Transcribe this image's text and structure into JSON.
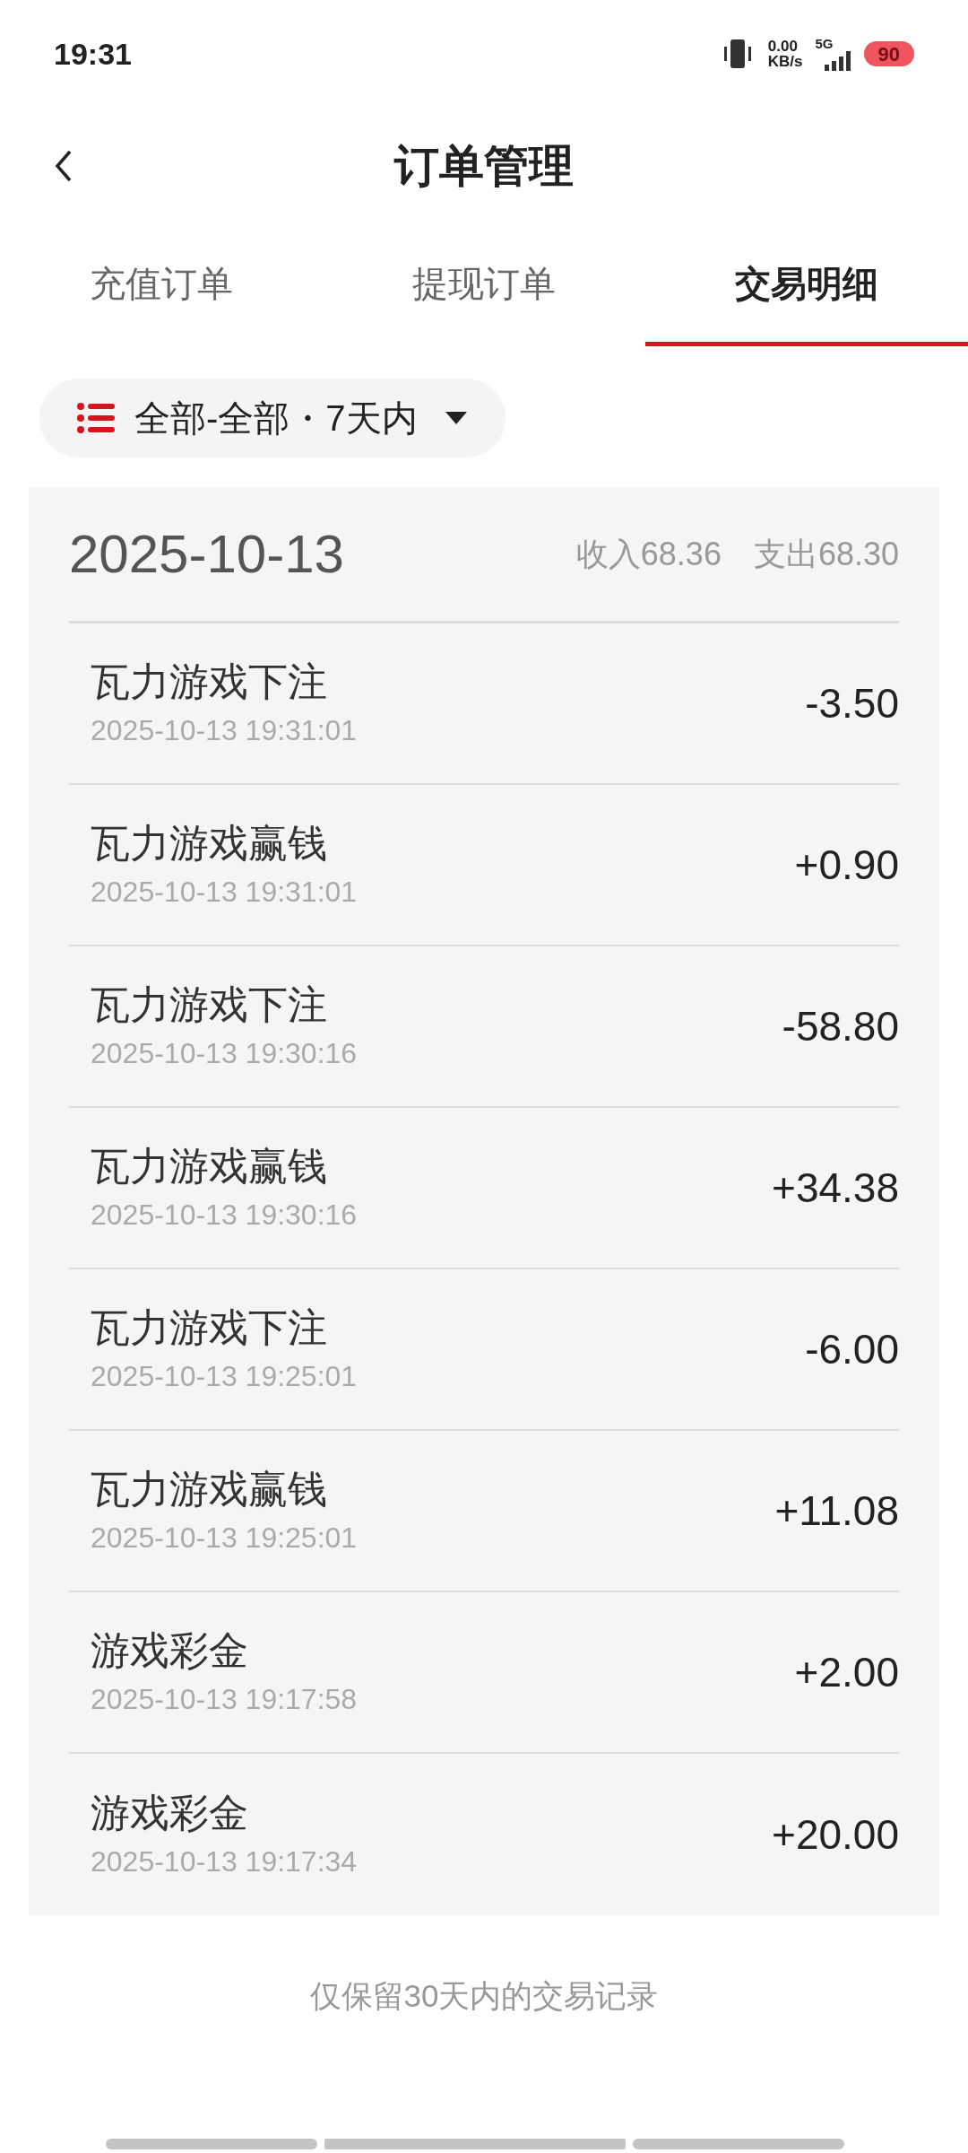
{
  "status_bar": {
    "time": "19:31",
    "speed_value": "0.00",
    "speed_unit": "KB/s",
    "network": "5G",
    "battery": "90"
  },
  "header": {
    "title": "订单管理"
  },
  "tabs": [
    {
      "label": "充值订单",
      "selected": false
    },
    {
      "label": "提现订单",
      "selected": false
    },
    {
      "label": "交易明细",
      "selected": true
    }
  ],
  "filter": {
    "label": "全部-全部・7天内"
  },
  "day": {
    "date": "2025-10-13",
    "income": "收入68.36",
    "expense": "支出68.30"
  },
  "transactions": [
    {
      "title": "瓦力游戏下注",
      "time": "2025-10-13 19:31:01",
      "amount": "-3.50"
    },
    {
      "title": "瓦力游戏赢钱",
      "time": "2025-10-13 19:31:01",
      "amount": "+0.90"
    },
    {
      "title": "瓦力游戏下注",
      "time": "2025-10-13 19:30:16",
      "amount": "-58.80"
    },
    {
      "title": "瓦力游戏赢钱",
      "time": "2025-10-13 19:30:16",
      "amount": "+34.38"
    },
    {
      "title": "瓦力游戏下注",
      "time": "2025-10-13 19:25:01",
      "amount": "-6.00"
    },
    {
      "title": "瓦力游戏赢钱",
      "time": "2025-10-13 19:25:01",
      "amount": "+11.08"
    },
    {
      "title": "游戏彩金",
      "time": "2025-10-13 19:17:58",
      "amount": "+2.00"
    },
    {
      "title": "游戏彩金",
      "time": "2025-10-13 19:17:34",
      "amount": "+20.00"
    }
  ],
  "footer": {
    "note": "仅保留30天内的交易记录"
  }
}
